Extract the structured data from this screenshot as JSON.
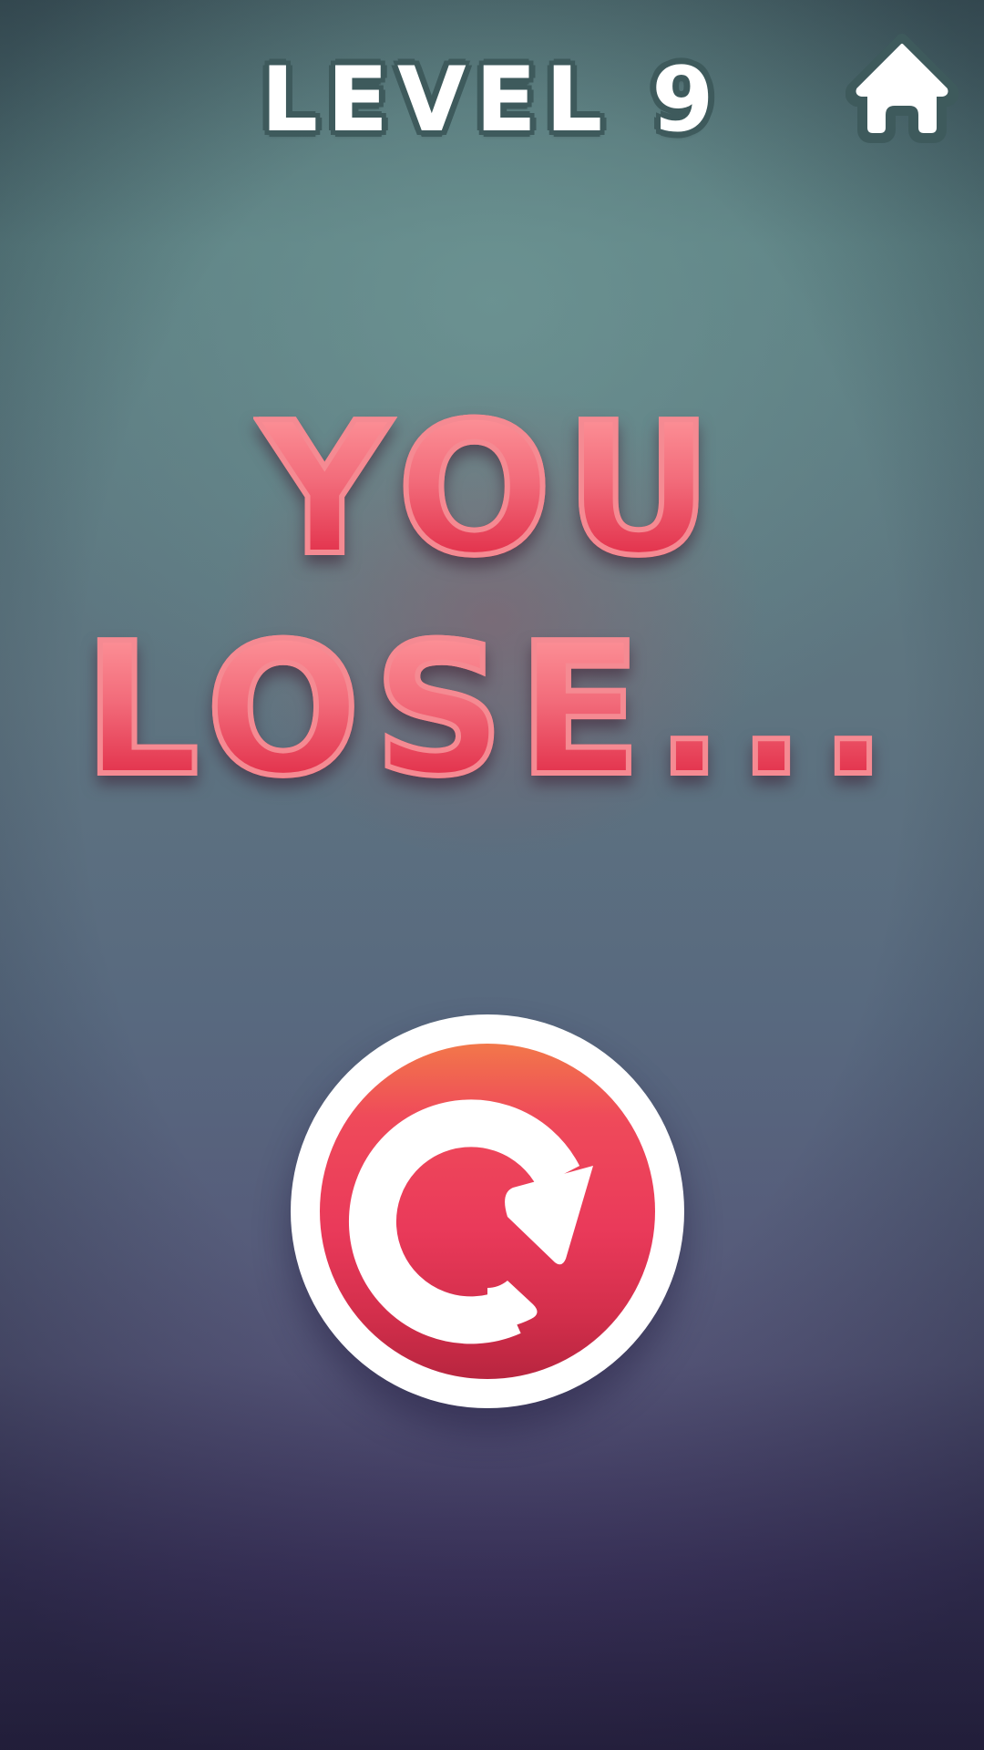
{
  "header": {
    "level_label": "LEVEL 9",
    "home_icon": "home-icon"
  },
  "result": {
    "line1": "YOU",
    "line2": "LOSE..."
  },
  "actions": {
    "retry_icon": "restart-icon"
  },
  "colors": {
    "text_outline": "#3e5a5c",
    "lose_text_top": "#ff9a9e",
    "lose_text_bottom": "#dd1e3c",
    "retry_top": "#f2774a",
    "retry_bottom": "#b8253f",
    "background_top": "#435c62",
    "background_bottom": "#2e2448"
  }
}
